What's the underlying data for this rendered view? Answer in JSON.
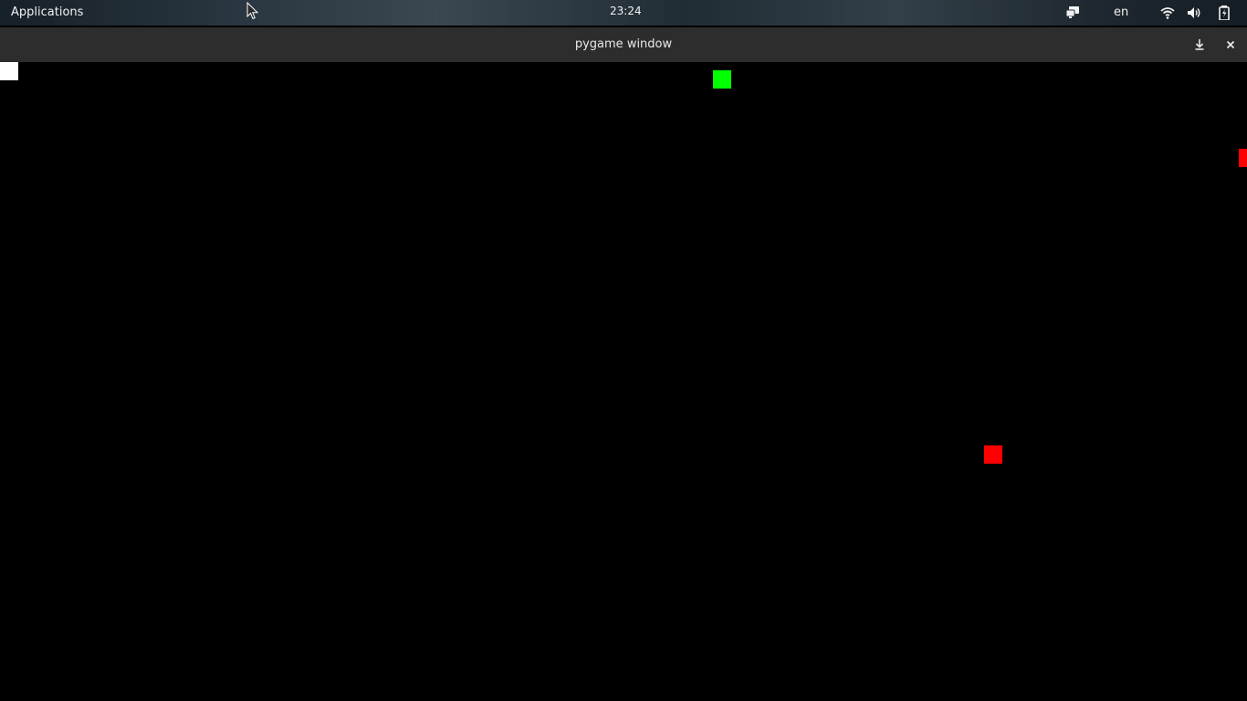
{
  "top_panel": {
    "applications_label": "Applications",
    "clock": "23:24",
    "language": "en",
    "tray_icons": [
      "display-icon",
      "wifi-icon",
      "volume-icon",
      "battery-icon"
    ]
  },
  "window": {
    "title": "pygame window",
    "buttons": [
      "download-icon",
      "close-icon"
    ]
  },
  "game": {
    "background_color": "#000000",
    "sprites": [
      {
        "name": "player-white-square",
        "color": "#ffffff"
      },
      {
        "name": "green-square",
        "color": "#00ff00"
      },
      {
        "name": "red-square-edge",
        "color": "#ff0000"
      },
      {
        "name": "red-square",
        "color": "#ff0000"
      }
    ]
  }
}
